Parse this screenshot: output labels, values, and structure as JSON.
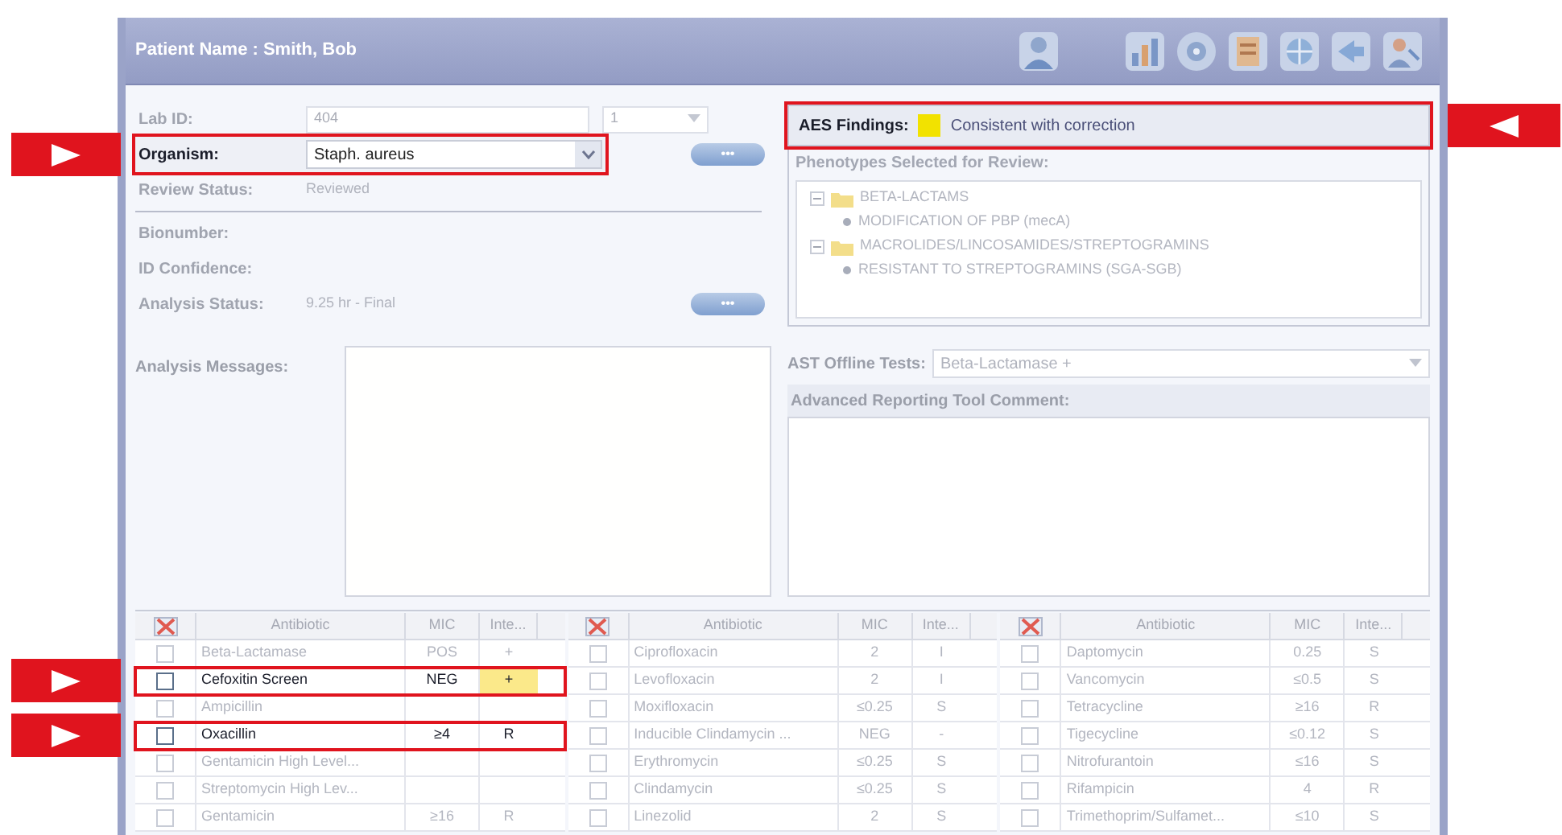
{
  "window": {
    "title": "Patient Name : Smith, Bob"
  },
  "identification": [
    {
      "kind": "input",
      "label": "Lab ID:",
      "value": "404",
      "selector": "1",
      "callout": false
    },
    {
      "kind": "select",
      "label": "Organism:",
      "value": "Staph. aureus",
      "button": "•••",
      "callout": true
    },
    {
      "kind": "text",
      "label": "Review Status:",
      "value": "Reviewed",
      "callout": false
    }
  ],
  "analysis": [
    {
      "kind": "text",
      "label": "Bionumber:",
      "callout": false
    },
    {
      "kind": "text",
      "label": "ID Confidence:",
      "callout": false
    },
    {
      "kind": "text",
      "label": "Analysis Status:",
      "value": "9.25 hr - Final",
      "button": "•••",
      "callout": false
    }
  ],
  "aes": {
    "label": "AES Findings:",
    "color": "#f2e200",
    "value": "Consistent with correction",
    "callout": true
  },
  "phenotypes": {
    "label": "Phenotypes Selected for Review:",
    "tree": [
      {
        "kind": "folder",
        "text": "BETA-LACTAMS",
        "expanded": true,
        "children": [
          {
            "kind": "leaf",
            "text": "MODIFICATION OF PBP (mecA)"
          }
        ]
      },
      {
        "kind": "folder",
        "text": "MACROLIDES/LINCOSAMIDES/STREPTOGRAMINS",
        "expanded": true,
        "children": [
          {
            "kind": "leaf",
            "text": "RESISTANT TO STREPTOGRAMINS (SGA-SGB)"
          }
        ]
      }
    ]
  },
  "analysis_messages": {
    "label": "Analysis Messages:"
  },
  "ast_offline_tests": {
    "label": "AST Offline Tests:",
    "value": "Beta-Lactamase +"
  },
  "comment": {
    "label": "Advanced Reporting Tool Comment:"
  },
  "tables": [
    {
      "columns": [
        "Antibiotic",
        "MIC",
        "Inte..."
      ],
      "rows": [
        {
          "antibiotic": "Beta-Lactamase",
          "mic": "POS",
          "interp": "+",
          "checked": false,
          "flagged": false,
          "callout": false
        },
        {
          "antibiotic": "Cefoxitin Screen",
          "mic": "NEG",
          "interp": "+",
          "checked": false,
          "flagged": true,
          "callout": true
        },
        {
          "antibiotic": "Ampicillin",
          "checked": false,
          "flagged": false,
          "callout": false
        },
        {
          "antibiotic": "Oxacillin",
          "mic": "≥4",
          "interp": "R",
          "checked": false,
          "flagged": false,
          "callout": true
        },
        {
          "antibiotic": "Gentamicin High Level...",
          "checked": false,
          "flagged": false,
          "callout": false
        },
        {
          "antibiotic": "Streptomycin High Lev...",
          "checked": false,
          "flagged": false,
          "callout": false
        },
        {
          "antibiotic": "Gentamicin",
          "mic": "≥16",
          "interp": "R",
          "checked": false,
          "flagged": false,
          "callout": false
        }
      ]
    },
    {
      "columns": [
        "Antibiotic",
        "MIC",
        "Inte..."
      ],
      "rows": [
        {
          "antibiotic": "Ciprofloxacin",
          "mic": "2",
          "interp": "I",
          "checked": false,
          "flagged": false,
          "callout": false
        },
        {
          "antibiotic": "Levofloxacin",
          "mic": "2",
          "interp": "I",
          "checked": false,
          "flagged": false,
          "callout": false
        },
        {
          "antibiotic": "Moxifloxacin",
          "mic": "≤0.25",
          "interp": "S",
          "checked": false,
          "flagged": false,
          "callout": false
        },
        {
          "antibiotic": "Inducible Clindamycin ...",
          "mic": "NEG",
          "interp": "-",
          "checked": false,
          "flagged": false,
          "callout": false
        },
        {
          "antibiotic": "Erythromycin",
          "mic": "≤0.25",
          "interp": "S",
          "checked": false,
          "flagged": false,
          "callout": false
        },
        {
          "antibiotic": "Clindamycin",
          "mic": "≤0.25",
          "interp": "S",
          "checked": false,
          "flagged": false,
          "callout": false
        },
        {
          "antibiotic": "Linezolid",
          "mic": "2",
          "interp": "S",
          "checked": false,
          "flagged": false,
          "callout": false
        }
      ]
    },
    {
      "columns": [
        "Antibiotic",
        "MIC",
        "Inte..."
      ],
      "rows": [
        {
          "antibiotic": "Daptomycin",
          "mic": "0.25",
          "interp": "S",
          "checked": false,
          "flagged": false,
          "callout": false
        },
        {
          "antibiotic": "Vancomycin",
          "mic": "≤0.5",
          "interp": "S",
          "checked": false,
          "flagged": false,
          "callout": false
        },
        {
          "antibiotic": "Tetracycline",
          "mic": "≥16",
          "interp": "R",
          "checked": false,
          "flagged": false,
          "callout": false
        },
        {
          "antibiotic": "Tigecycline",
          "mic": "≤0.12",
          "interp": "S",
          "checked": false,
          "flagged": false,
          "callout": false
        },
        {
          "antibiotic": "Nitrofurantoin",
          "mic": "≤16",
          "interp": "S",
          "checked": false,
          "flagged": false,
          "callout": false
        },
        {
          "antibiotic": "Rifampicin",
          "mic": "4",
          "interp": "R",
          "checked": false,
          "flagged": false,
          "callout": false
        },
        {
          "antibiotic": "Trimethoprim/Sulfamet...",
          "mic": "≤10",
          "interp": "S",
          "checked": false,
          "flagged": false,
          "callout": false
        }
      ]
    }
  ]
}
